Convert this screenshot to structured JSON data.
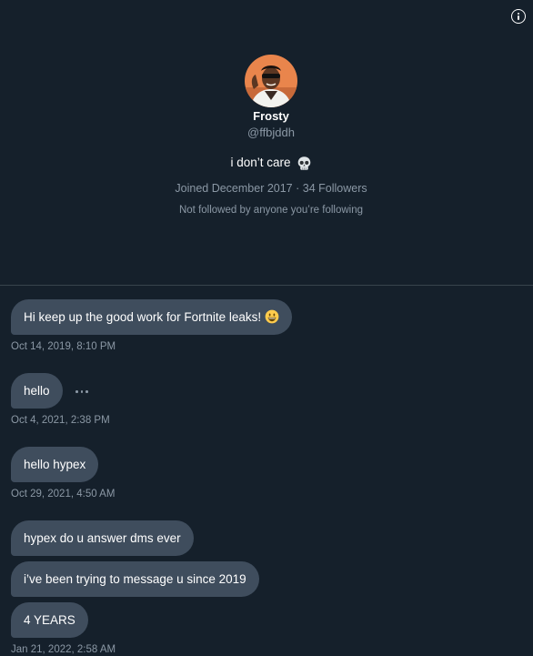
{
  "profile": {
    "name": "Frosty",
    "handle": "@ffbjddh",
    "bio": "i don’t care",
    "bio_emoji": "skull-emoji",
    "joined": "Joined December 2017 · 34 Followers",
    "not_followed": "Not followed by anyone you’re following"
  },
  "messages": [
    {
      "text": "Hi keep up the good work for Fortnite leaks!",
      "emoji": "grinning-face-emoji",
      "timestamp": "Oct 14, 2019, 8:10 PM"
    },
    {
      "text": "hello",
      "timestamp": "Oct 4, 2021, 2:38 PM"
    },
    {
      "text": "hello hypex",
      "timestamp": "Oct 29, 2021, 4:50 AM"
    },
    {
      "text": "hypex do u answer dms ever"
    },
    {
      "text": "i’ve been trying to message u since 2019"
    },
    {
      "text": "4 YEARS",
      "timestamp": "Jan 21, 2022, 2:58 AM"
    }
  ],
  "icons": {
    "info": "info-icon",
    "more": "more-horizontal-icon"
  },
  "colors": {
    "background": "#15202b",
    "bubble": "#3f4d5d",
    "secondary_text": "#8b98a5",
    "divider": "#38444d"
  }
}
